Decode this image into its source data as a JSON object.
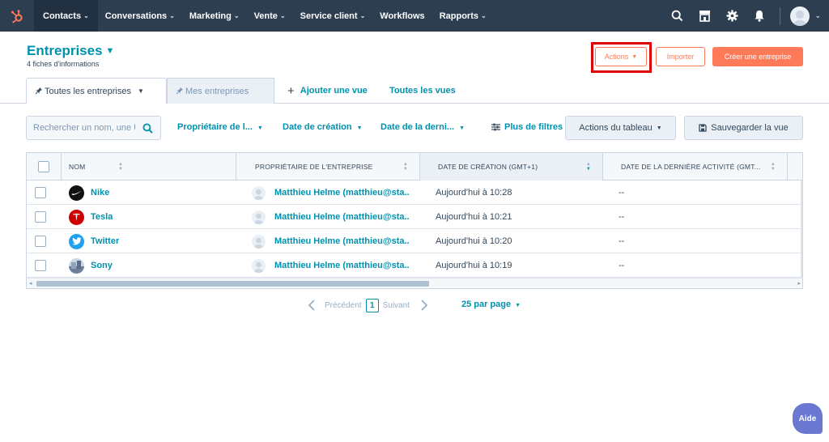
{
  "nav": {
    "items": [
      {
        "label": "Contacts",
        "active": true
      },
      {
        "label": "Conversations"
      },
      {
        "label": "Marketing"
      },
      {
        "label": "Vente"
      },
      {
        "label": "Service client"
      },
      {
        "label": "Workflows"
      },
      {
        "label": "Rapports"
      }
    ],
    "chevron": "⌄",
    "icons": [
      "search-icon",
      "marketplace-icon",
      "gear-icon",
      "bell-icon",
      "avatar",
      "chevron-down-icon"
    ]
  },
  "header": {
    "title": "Entreprises",
    "title_caret": "▼",
    "subtitle": "4 fiches d'informations",
    "actions_label": "Actions",
    "actions_caret": "▼",
    "import_label": "Importer",
    "create_label": "Créer une entreprise"
  },
  "tabs": {
    "all": "Toutes les entreprises",
    "all_caret": "▼",
    "mine": "Mes entreprises",
    "add_plus": "+",
    "add": "Ajouter une vue",
    "all_views": "Toutes les vues"
  },
  "filters": {
    "search_placeholder": "Rechercher un nom, une URL de domaine ou un numéro de téléphone",
    "owner": "Propriétaire de l...",
    "created": "Date de création",
    "last": "Date de la derni...",
    "caret": "▼",
    "more": "Plus de filtres",
    "table_actions": "Actions du tableau",
    "save_view": "Sauvegarder la vue"
  },
  "table": {
    "columns": [
      "NOM",
      "PROPRIÉTAIRE DE L'ENTREPRISE",
      "DATE DE CRÉATION (GMT+1)",
      "DATE DE LA DERNIÈRE ACTIVITÉ (GMT..."
    ],
    "sort_up": "▲",
    "sort_down": "▼",
    "rows": [
      {
        "name": "Nike",
        "logo": "nike-logo",
        "owner": "Matthieu Helme (matthieu@sta...",
        "created": "Aujourd'hui à 10:28",
        "last": "--"
      },
      {
        "name": "Tesla",
        "logo": "tesla-logo",
        "owner": "Matthieu Helme (matthieu@sta...",
        "created": "Aujourd'hui à 10:21",
        "last": "--"
      },
      {
        "name": "Twitter",
        "logo": "twitter-logo",
        "owner": "Matthieu Helme (matthieu@sta...",
        "created": "Aujourd'hui à 10:20",
        "last": "--"
      },
      {
        "name": "Sony",
        "logo": "sony-logo",
        "owner": "Matthieu Helme (matthieu@sta...",
        "created": "Aujourd'hui à 10:19",
        "last": "--"
      }
    ],
    "scroll_left": "◂",
    "scroll_right": "▸"
  },
  "pagination": {
    "prev": "Précédent",
    "page": "1",
    "next": "Suivant",
    "per_page": "25 par page",
    "caret": "▼"
  },
  "help_label": "Aide",
  "colors": {
    "nav": "#2d3e50",
    "accent": "#0091ae",
    "orange": "#ff7a59",
    "highlight": "#e00000"
  }
}
